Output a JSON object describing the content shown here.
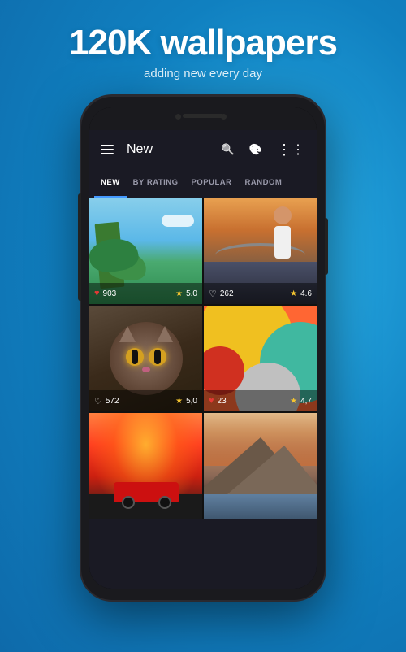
{
  "page": {
    "background_color": "#1e90d4",
    "title": "120K wallpapers",
    "subtitle": "adding new every day"
  },
  "app": {
    "topbar": {
      "title": "New",
      "search_label": "search",
      "palette_label": "palette",
      "more_label": "more options"
    },
    "tabs": [
      {
        "id": "new",
        "label": "NEW",
        "active": true
      },
      {
        "id": "by-rating",
        "label": "BY RATING",
        "active": false
      },
      {
        "id": "popular",
        "label": "POPULAR",
        "active": false
      },
      {
        "id": "random",
        "label": "RANDOM",
        "active": false
      }
    ],
    "grid": [
      {
        "id": "cell-1",
        "theme": "tropical",
        "likes": "903",
        "heart_filled": true,
        "rating": "5.0"
      },
      {
        "id": "cell-2",
        "theme": "bridge",
        "likes": "262",
        "heart_filled": false,
        "rating": "4.6"
      },
      {
        "id": "cell-3",
        "theme": "cat",
        "likes": "572",
        "heart_filled": false,
        "rating": "5,0"
      },
      {
        "id": "cell-4",
        "theme": "circles",
        "likes": "23",
        "heart_filled": true,
        "rating": "4,7"
      },
      {
        "id": "cell-5",
        "theme": "car",
        "likes": "",
        "heart_filled": false,
        "rating": ""
      },
      {
        "id": "cell-6",
        "theme": "mountains",
        "likes": "",
        "heart_filled": false,
        "rating": ""
      }
    ]
  }
}
